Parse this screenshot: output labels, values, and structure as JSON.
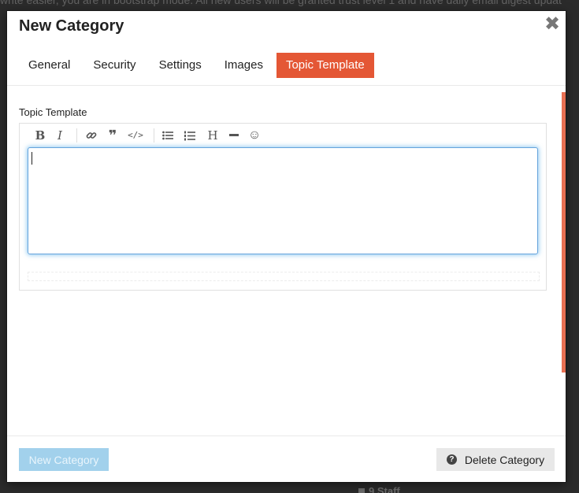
{
  "backdrop": {
    "banner_text": "write easier, you are in bootstrap mode. All new users will be granted trust level 1 and have daily email digest updat",
    "staff_text": "9 Staff"
  },
  "modal": {
    "title": "New Category",
    "close_icon": "close-icon"
  },
  "tabs": [
    {
      "label": "General",
      "active": false
    },
    {
      "label": "Security",
      "active": false
    },
    {
      "label": "Settings",
      "active": false
    },
    {
      "label": "Images",
      "active": false
    },
    {
      "label": "Topic Template",
      "active": true
    }
  ],
  "editor": {
    "label": "Topic Template",
    "value": "",
    "toolbar": [
      {
        "name": "bold",
        "glyph": "B"
      },
      {
        "name": "italic",
        "glyph": "I"
      },
      {
        "name": "link",
        "glyph": "🔗"
      },
      {
        "name": "quote",
        "glyph": "❞"
      },
      {
        "name": "code",
        "glyph": "</>"
      },
      {
        "name": "bullet-list",
        "glyph": "☰"
      },
      {
        "name": "numbered-list",
        "glyph": "☷"
      },
      {
        "name": "heading",
        "glyph": "H"
      },
      {
        "name": "horizontal-rule",
        "glyph": "▬"
      },
      {
        "name": "emoji",
        "glyph": "☺"
      }
    ]
  },
  "footer": {
    "create_label": "New Category",
    "delete_label": "Delete Category",
    "delete_icon": "question-circle-icon"
  },
  "colors": {
    "accent": "#e45735",
    "primary_disabled": "#a2d1ec",
    "focus_blue": "#65a3dc"
  }
}
